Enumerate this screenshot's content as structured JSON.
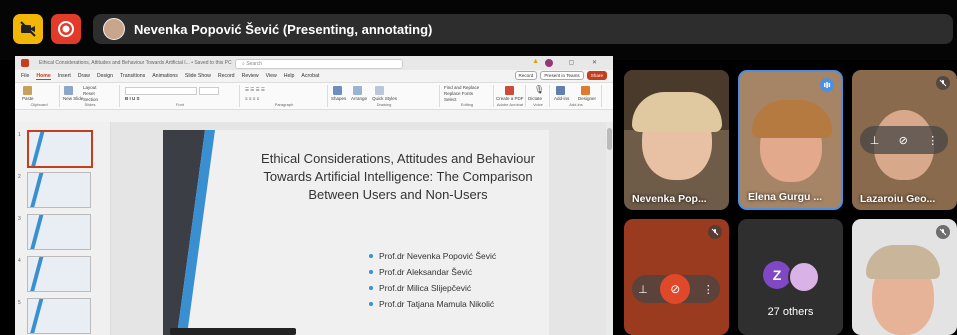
{
  "meeting": {
    "presenter_status": "Nevenka Popović Šević (Presenting, annotating)"
  },
  "powerpoint": {
    "title_bar": "Ethical Considerations, Attitudes and Behaviour Towards Artificial I... • Saved to this PC",
    "search_placeholder": "Search",
    "menu": [
      "File",
      "Home",
      "Insert",
      "Draw",
      "Design",
      "Transitions",
      "Animations",
      "Slide Show",
      "Record",
      "Review",
      "View",
      "Help",
      "Acrobat"
    ],
    "active_menu": "Home",
    "record_label": "Record",
    "present_teams_label": "Present in Teams",
    "share_label": "Share",
    "ribbon_groups": [
      "Clipboard",
      "Slides",
      "Font",
      "Paragraph",
      "Drawing",
      "Editing",
      "Adobe Acrobat",
      "Voice",
      "Add-ins"
    ],
    "ribbon_buttons": {
      "paste": "Paste",
      "new_slide": "New Slide",
      "layout": "Layout",
      "reset": "Reset",
      "section": "Section",
      "shapes": "Shapes",
      "arrange": "Arrange",
      "quick_styles": "Quick Styles",
      "find_replace": "Find and Replace",
      "replace_fonts": "Replace Fonts",
      "select": "Select",
      "create_pdf": "Create a PDF",
      "dictate": "Dictate",
      "addins": "Add-ins",
      "designer": "Designer"
    },
    "thumbnail_numbers": [
      "1",
      "2",
      "3",
      "4",
      "5"
    ],
    "slide": {
      "title_lines": [
        "Ethical Considerations, Attitudes and Behaviour",
        "Towards Artificial Intelligence: The Comparison",
        "Between Users and Non-Users"
      ],
      "authors": [
        "Prof.dr Nevenka Popović Šević",
        "Prof.dr Aleksandar Šević",
        "Prof.dr Milica Slijepčević",
        "Prof.dr Tatjana Mamula Nikolić"
      ]
    }
  },
  "participants": {
    "tile1_name": "Nevenka Pop...",
    "tile2_name": "Elena Gurgu ...",
    "tile3_name": "Lazaroiu Geo...",
    "others_initial": "Z",
    "others_label": "27 others"
  },
  "colors": {
    "camera_off_button": "#f2b705",
    "record_button": "#e23b2a",
    "powerpoint_accent": "#c43e1c",
    "slide_accent": "#3a8fd0",
    "speaking_indicator": "#4d8fe0",
    "others_avatar": "#8048c4"
  }
}
